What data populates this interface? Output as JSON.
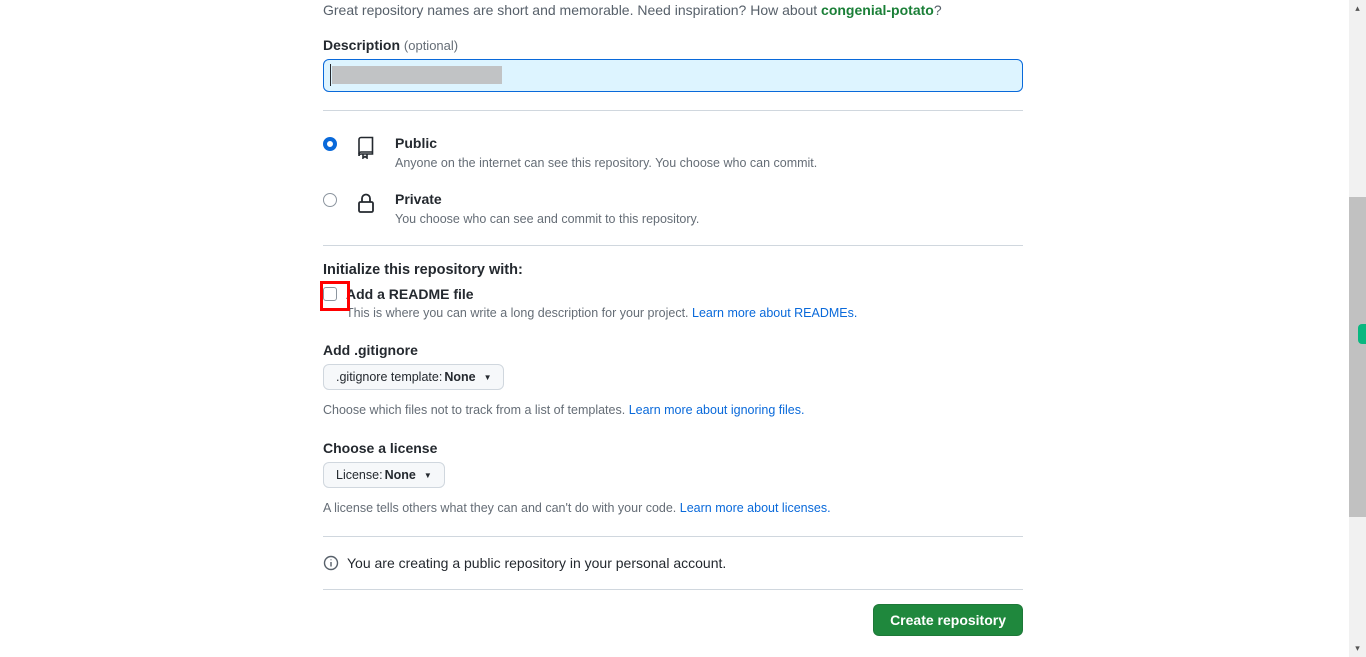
{
  "intro": {
    "text_before": "Great repository names are short and memorable. Need inspiration? How about ",
    "suggestion": "congenial-potato",
    "text_after": "?"
  },
  "description": {
    "label": "Description",
    "optional": "(optional)",
    "value": ""
  },
  "visibility": {
    "public": {
      "title": "Public",
      "desc": "Anyone on the internet can see this repository. You choose who can commit."
    },
    "private": {
      "title": "Private",
      "desc": "You choose who can see and commit to this repository."
    }
  },
  "initialize": {
    "heading": "Initialize this repository with:",
    "readme_label": "Add a README file",
    "readme_help_before": "This is where you can write a long description for your project. ",
    "readme_link": "Learn more about READMEs.",
    "gitignore_heading": "Add .gitignore",
    "gitignore_btn_label": ".gitignore template: ",
    "gitignore_btn_value": "None",
    "gitignore_help_before": "Choose which files not to track from a list of templates. ",
    "gitignore_link": "Learn more about ignoring files.",
    "license_heading": "Choose a license",
    "license_btn_label": "License: ",
    "license_btn_value": "None",
    "license_help_before": "A license tells others what they can and can't do with your code. ",
    "license_link": "Learn more about licenses."
  },
  "info_message": "You are creating a public repository in your personal account.",
  "submit_label": "Create repository"
}
